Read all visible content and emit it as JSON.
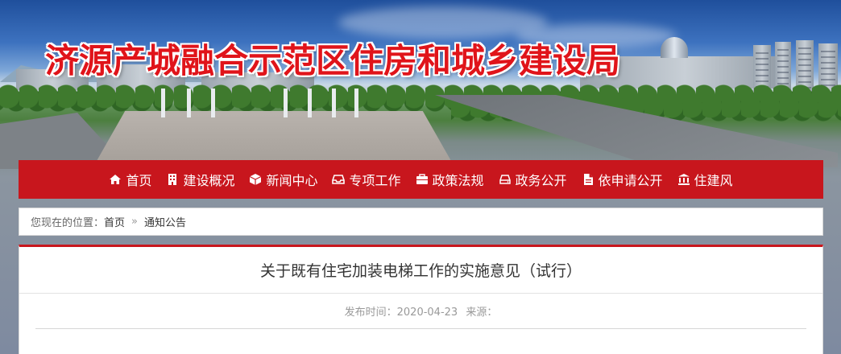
{
  "site": {
    "title": "济源产城融合示范区住房和城乡建设局"
  },
  "nav": {
    "items": [
      {
        "label": "首页",
        "icon": "home-icon"
      },
      {
        "label": "建设概况",
        "icon": "building-icon"
      },
      {
        "label": "新闻中心",
        "icon": "cube-icon"
      },
      {
        "label": "专项工作",
        "icon": "inbox-icon"
      },
      {
        "label": "政策法规",
        "icon": "briefcase-icon"
      },
      {
        "label": "政务公开",
        "icon": "drive-icon"
      },
      {
        "label": "依申请公开",
        "icon": "file-icon"
      },
      {
        "label": "住建风",
        "icon": "institution-icon"
      }
    ],
    "background": "#c8161d"
  },
  "breadcrumb": {
    "prefix": "您现在的位置：",
    "home": "首页",
    "separator": "»",
    "current": "通知公告"
  },
  "article": {
    "title": "关于既有住宅加装电梯工作的实施意见（试行）",
    "published_label": "发布时间：2020-04-23",
    "source_label": "来源："
  },
  "colors": {
    "accent": "#c8161d",
    "title_red": "#e0141a"
  }
}
